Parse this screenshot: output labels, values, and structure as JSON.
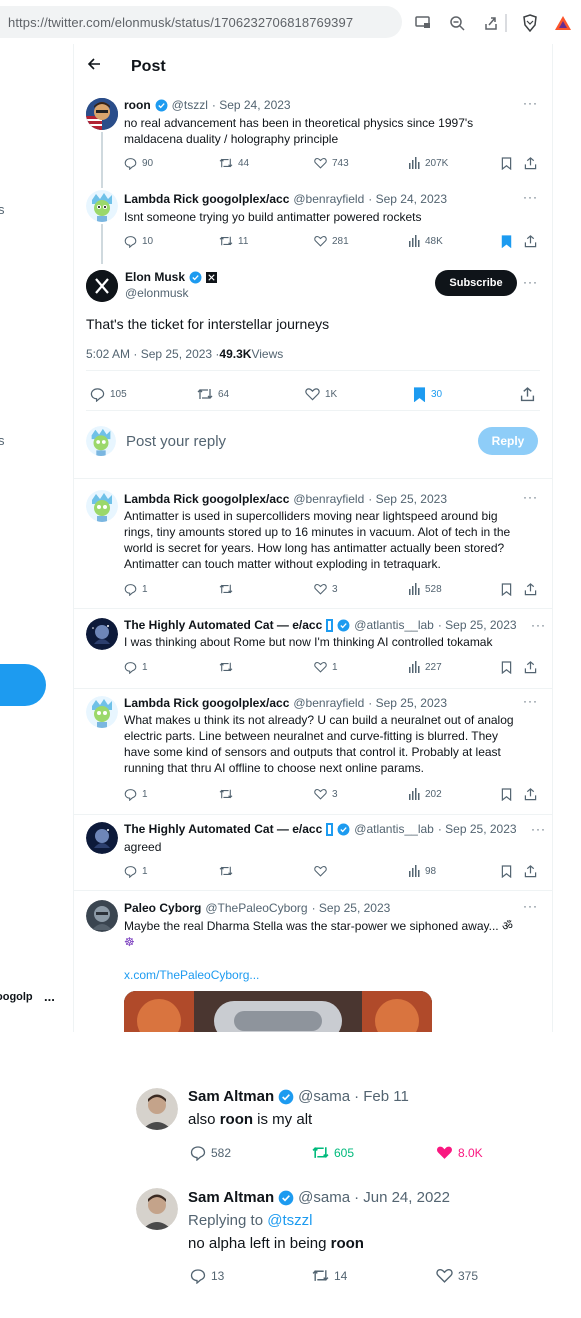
{
  "browser": {
    "url": "https://twitter.com/elonmusk/status/1706232706818769397",
    "icons": [
      "cast-icon",
      "zoom-out-icon",
      "share-icon",
      "brave-shield-icon",
      "brave-rewards-icon"
    ]
  },
  "left_nav": {
    "frag1": "s",
    "frag2": "s",
    "frag3": "oogolp",
    "dots": "..."
  },
  "header": {
    "title": "Post",
    "back_icon": "arrow-left-icon"
  },
  "colors": {
    "accent": "#1d9bf0",
    "like_pink": "#f91880",
    "retweet_green": "#00ba7c"
  },
  "parent_tweets": [
    {
      "name": "roon",
      "handle": "@tszzl",
      "date": "· Sep 24, 2023",
      "verified": true,
      "text": "no real advancement has been in theoretical physics since 1997's maldacena duality / holography principle",
      "replies": "90",
      "retweets": "44",
      "likes": "743",
      "views": "207K",
      "bookmarked": false
    },
    {
      "name": "Lambda Rick googolplex/acc",
      "handle": "@benrayfield",
      "date": "· Sep 24, 2023",
      "verified": false,
      "text": "Isnt someone trying yo build antimatter powered rockets",
      "replies": "10",
      "retweets": "11",
      "likes": "281",
      "views": "48K",
      "bookmarked": true
    }
  ],
  "main_tweet": {
    "name": "Elon Musk",
    "handle": "@elonmusk",
    "subscribe_label": "Subscribe",
    "text": "That's the ticket for interstellar journeys",
    "time": "5:02 AM · Sep 25, 2023 · ",
    "views_count": "49.3K",
    "views_label": " Views",
    "replies": "105",
    "retweets": "64",
    "likes": "1K",
    "bookmarks": "30"
  },
  "compose": {
    "placeholder": "Post your reply",
    "button": "Reply"
  },
  "replies": [
    {
      "name": "Lambda Rick googolplex/acc",
      "handle": "@benrayfield",
      "date": "· Sep 25, 2023",
      "lines": [
        "Antimatter is used in supercolliders moving near lightspeed around big",
        "rings, tiny amounts stored up to 16 minutes in vacuum. Alot of tech in the",
        "world is secret for years. How long has antimatter actually been stored?",
        "Antimatter can touch matter without exploding in tetraquark."
      ],
      "replies": "1",
      "retweets": "",
      "likes": "3",
      "views": "528"
    },
    {
      "name": "The Highly Automated Cat — e/acc",
      "handle": "@atlantis__lab",
      "date": "· Sep 25, 2023",
      "lines": [
        "I was thinking about Rome but now I'm thinking AI controlled tokamak"
      ],
      "replies": "1",
      "retweets": "",
      "likes": "1",
      "views": "227"
    },
    {
      "name": "Lambda Rick googolplex/acc",
      "handle": "@benrayfield",
      "date": "· Sep 25, 2023",
      "lines": [
        "What makes u think its not already? U can build a neuralnet out of analog",
        "electric parts. Line between neuralnet and curve-fitting is blurred. They",
        "have some kind of sensors and outputs that control it. Probably at least",
        "running that thru AI offline to choose next online params."
      ],
      "replies": "1",
      "retweets": "",
      "likes": "3",
      "views": "202"
    },
    {
      "name": "The Highly Automated Cat — e/acc",
      "handle": "@atlantis__lab",
      "date": "· Sep 25, 2023",
      "lines": [
        "agreed"
      ],
      "replies": "1",
      "retweets": "",
      "likes": "",
      "views": "98"
    },
    {
      "name": "Paleo Cyborg",
      "handle": "@ThePaleoCyborg",
      "date": "· Sep 25, 2023",
      "lines": [
        "Maybe the real Dharma Stella was the star-power we siphoned away... ॐ",
        "☸"
      ],
      "link": "x.com/ThePaleoCyborg..."
    }
  ],
  "overlay": [
    {
      "name": "Sam Altman",
      "handle": "@sama",
      "date": "· Feb 11",
      "text_pre": "also ",
      "text_bold": "roon",
      "text_post": " is my alt",
      "replies": "582",
      "retweets": "605",
      "likes": "8.0K"
    },
    {
      "name": "Sam Altman",
      "handle": "@sama",
      "date": "· Jun 24, 2022",
      "replying_label": "Replying to ",
      "replying_handle": "@tszzl",
      "text_pre": "no alpha left in being ",
      "text_bold": "roon",
      "text_post": "",
      "replies": "13",
      "retweets": "14",
      "likes": "375"
    }
  ]
}
